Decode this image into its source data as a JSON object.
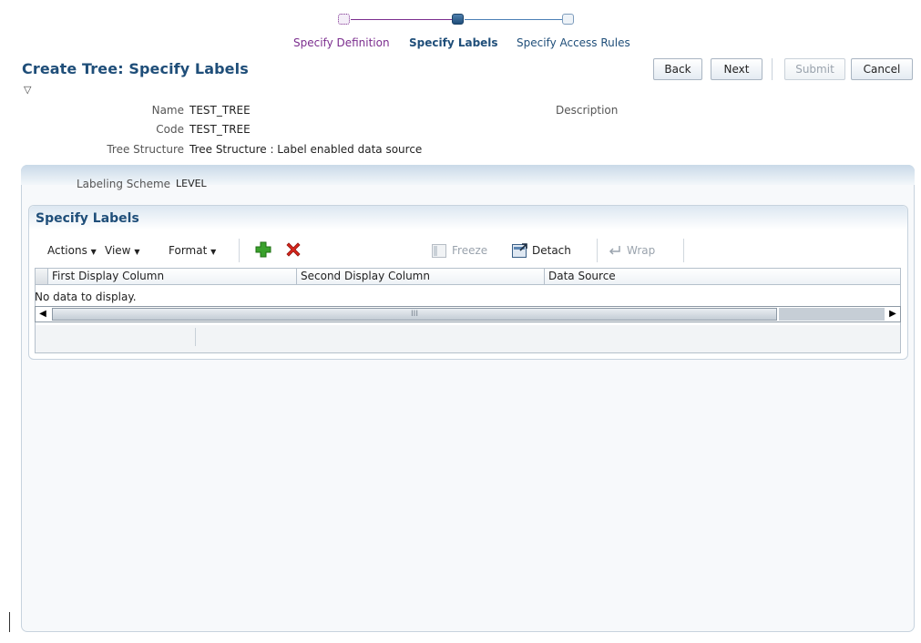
{
  "train": {
    "steps": [
      {
        "label": "Specify Definition",
        "state": "visited"
      },
      {
        "label": "Specify Labels",
        "state": "current"
      },
      {
        "label": "Specify Access Rules",
        "state": "unvisited"
      }
    ]
  },
  "header": {
    "title": "Create Tree: Specify Labels",
    "disclosure_glyph": "▽",
    "buttons": {
      "back": "Back",
      "next": "Next",
      "submit": "Submit",
      "cancel": "Cancel"
    }
  },
  "summary": {
    "name_label": "Name",
    "name_value": "TEST_TREE",
    "code_label": "Code",
    "code_value": "TEST_TREE",
    "structure_label": "Tree Structure",
    "structure_value": "Tree Structure : Label enabled data source",
    "description_label": "Description"
  },
  "labeling": {
    "label": "Labeling Scheme",
    "value": "LEVEL"
  },
  "specify_labels": {
    "title": "Specify Labels",
    "toolbar": {
      "actions": "Actions",
      "view": "View",
      "format": "Format",
      "freeze": "Freeze",
      "detach": "Detach",
      "wrap": "Wrap"
    },
    "columns": [
      "First Display Column",
      "Second Display Column",
      "Data Source"
    ],
    "empty_text": "No data to display.",
    "scroll_grip": "III"
  },
  "colors": {
    "accent_title": "#1f4e79",
    "train_visited": "#7b2d8e",
    "train_current": "#1f4e79",
    "add_icon": "#3aa12c",
    "delete_icon": "#d8261c"
  }
}
